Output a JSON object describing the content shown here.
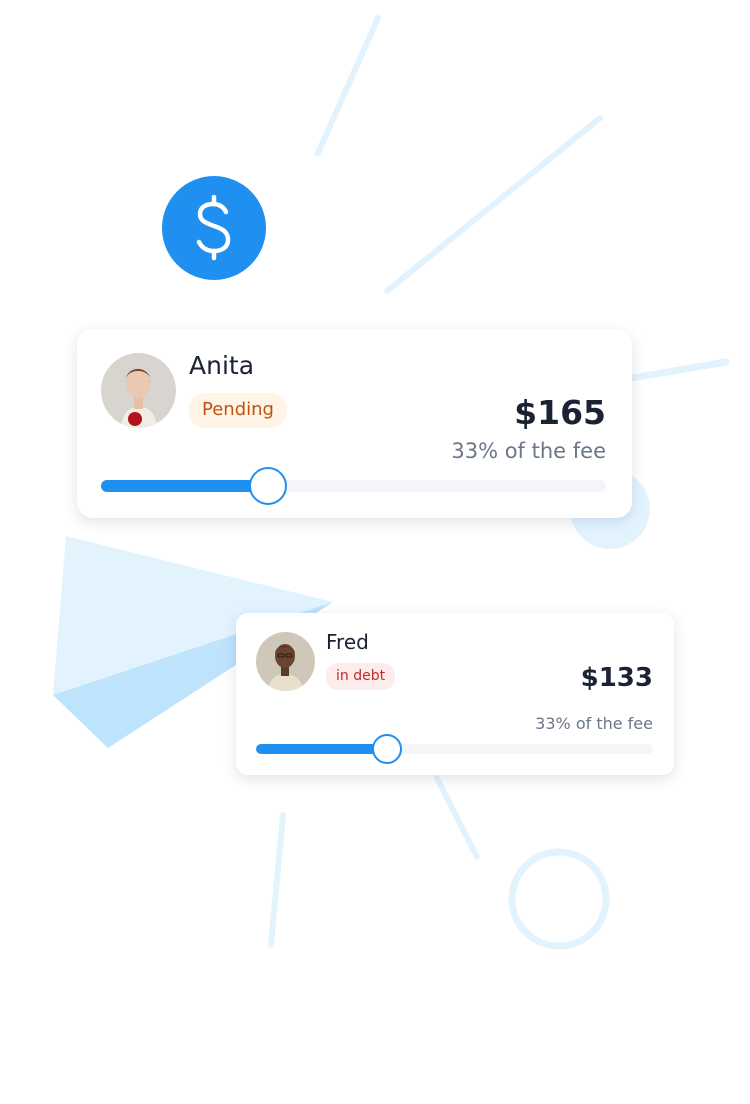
{
  "colors": {
    "accent": "#1f8ff0",
    "pending_bg": "#fff4e6",
    "pending_text": "#c0530f",
    "debt_bg": "#fdecec",
    "debt_text": "#c62828",
    "decor": "#e3f3fe"
  },
  "hero_icon": "dollar-icon",
  "cards": [
    {
      "name": "Anita",
      "status": "Pending",
      "amount": "$165",
      "share": "33% of the fee",
      "slider_value": 0.33
    },
    {
      "name": "Fred",
      "status": "in debt",
      "amount": "$133",
      "share": "33% of the fee",
      "slider_value": 0.33
    }
  ]
}
